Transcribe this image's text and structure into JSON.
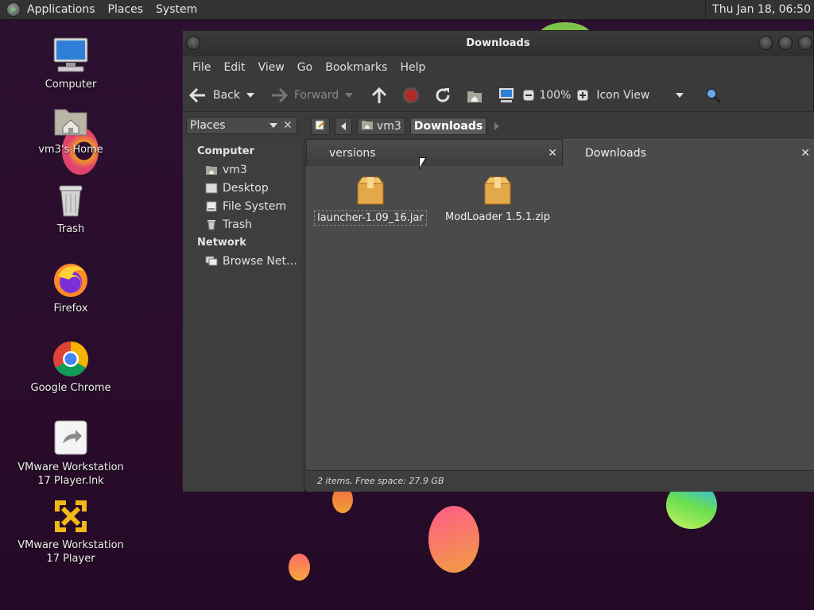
{
  "panel": {
    "menus": [
      "Applications",
      "Places",
      "System"
    ],
    "clock": "Thu Jan 18, 06:50"
  },
  "desktop": {
    "icons": [
      {
        "label": "Computer",
        "icon": "computer-icon"
      },
      {
        "label": "vm3's Home",
        "icon": "home-folder-icon"
      },
      {
        "label": "Trash",
        "icon": "trash-icon"
      },
      {
        "label": "Firefox",
        "icon": "firefox-icon"
      },
      {
        "label": "Google Chrome",
        "icon": "chrome-icon"
      },
      {
        "label": "VMware Workstation 17 Player.lnk",
        "line1": "VMware Workstation",
        "line2": "17 Player.lnk",
        "icon": "shortcut-icon"
      },
      {
        "label": "VMware Workstation 17 Player",
        "line1": "VMware Workstation",
        "line2": "17 Player",
        "icon": "vmware-icon"
      }
    ]
  },
  "window": {
    "title": "Downloads",
    "menu": [
      "File",
      "Edit",
      "View",
      "Go",
      "Bookmarks",
      "Help"
    ],
    "toolbar": {
      "back": "Back",
      "forward": "Forward",
      "zoom": "100%",
      "view_mode": "Icon View"
    },
    "sidepane": {
      "selector": "Places",
      "sections": [
        {
          "heading": "Computer",
          "items": [
            "vm3",
            "Desktop",
            "File System",
            "Trash"
          ]
        },
        {
          "heading": "Network",
          "items": [
            "Browse Net…"
          ]
        }
      ]
    },
    "location": {
      "crumbs": [
        "vm3",
        "Downloads"
      ]
    },
    "tabs": [
      {
        "label": "versions",
        "active": false
      },
      {
        "label": "Downloads",
        "active": true
      }
    ],
    "files": [
      {
        "name": "launcher-1.09_16.jar",
        "selected": true
      },
      {
        "name": "ModLoader 1.5.1.zip",
        "selected": false
      }
    ],
    "status": "2 items, Free space: 27.9 GB"
  }
}
